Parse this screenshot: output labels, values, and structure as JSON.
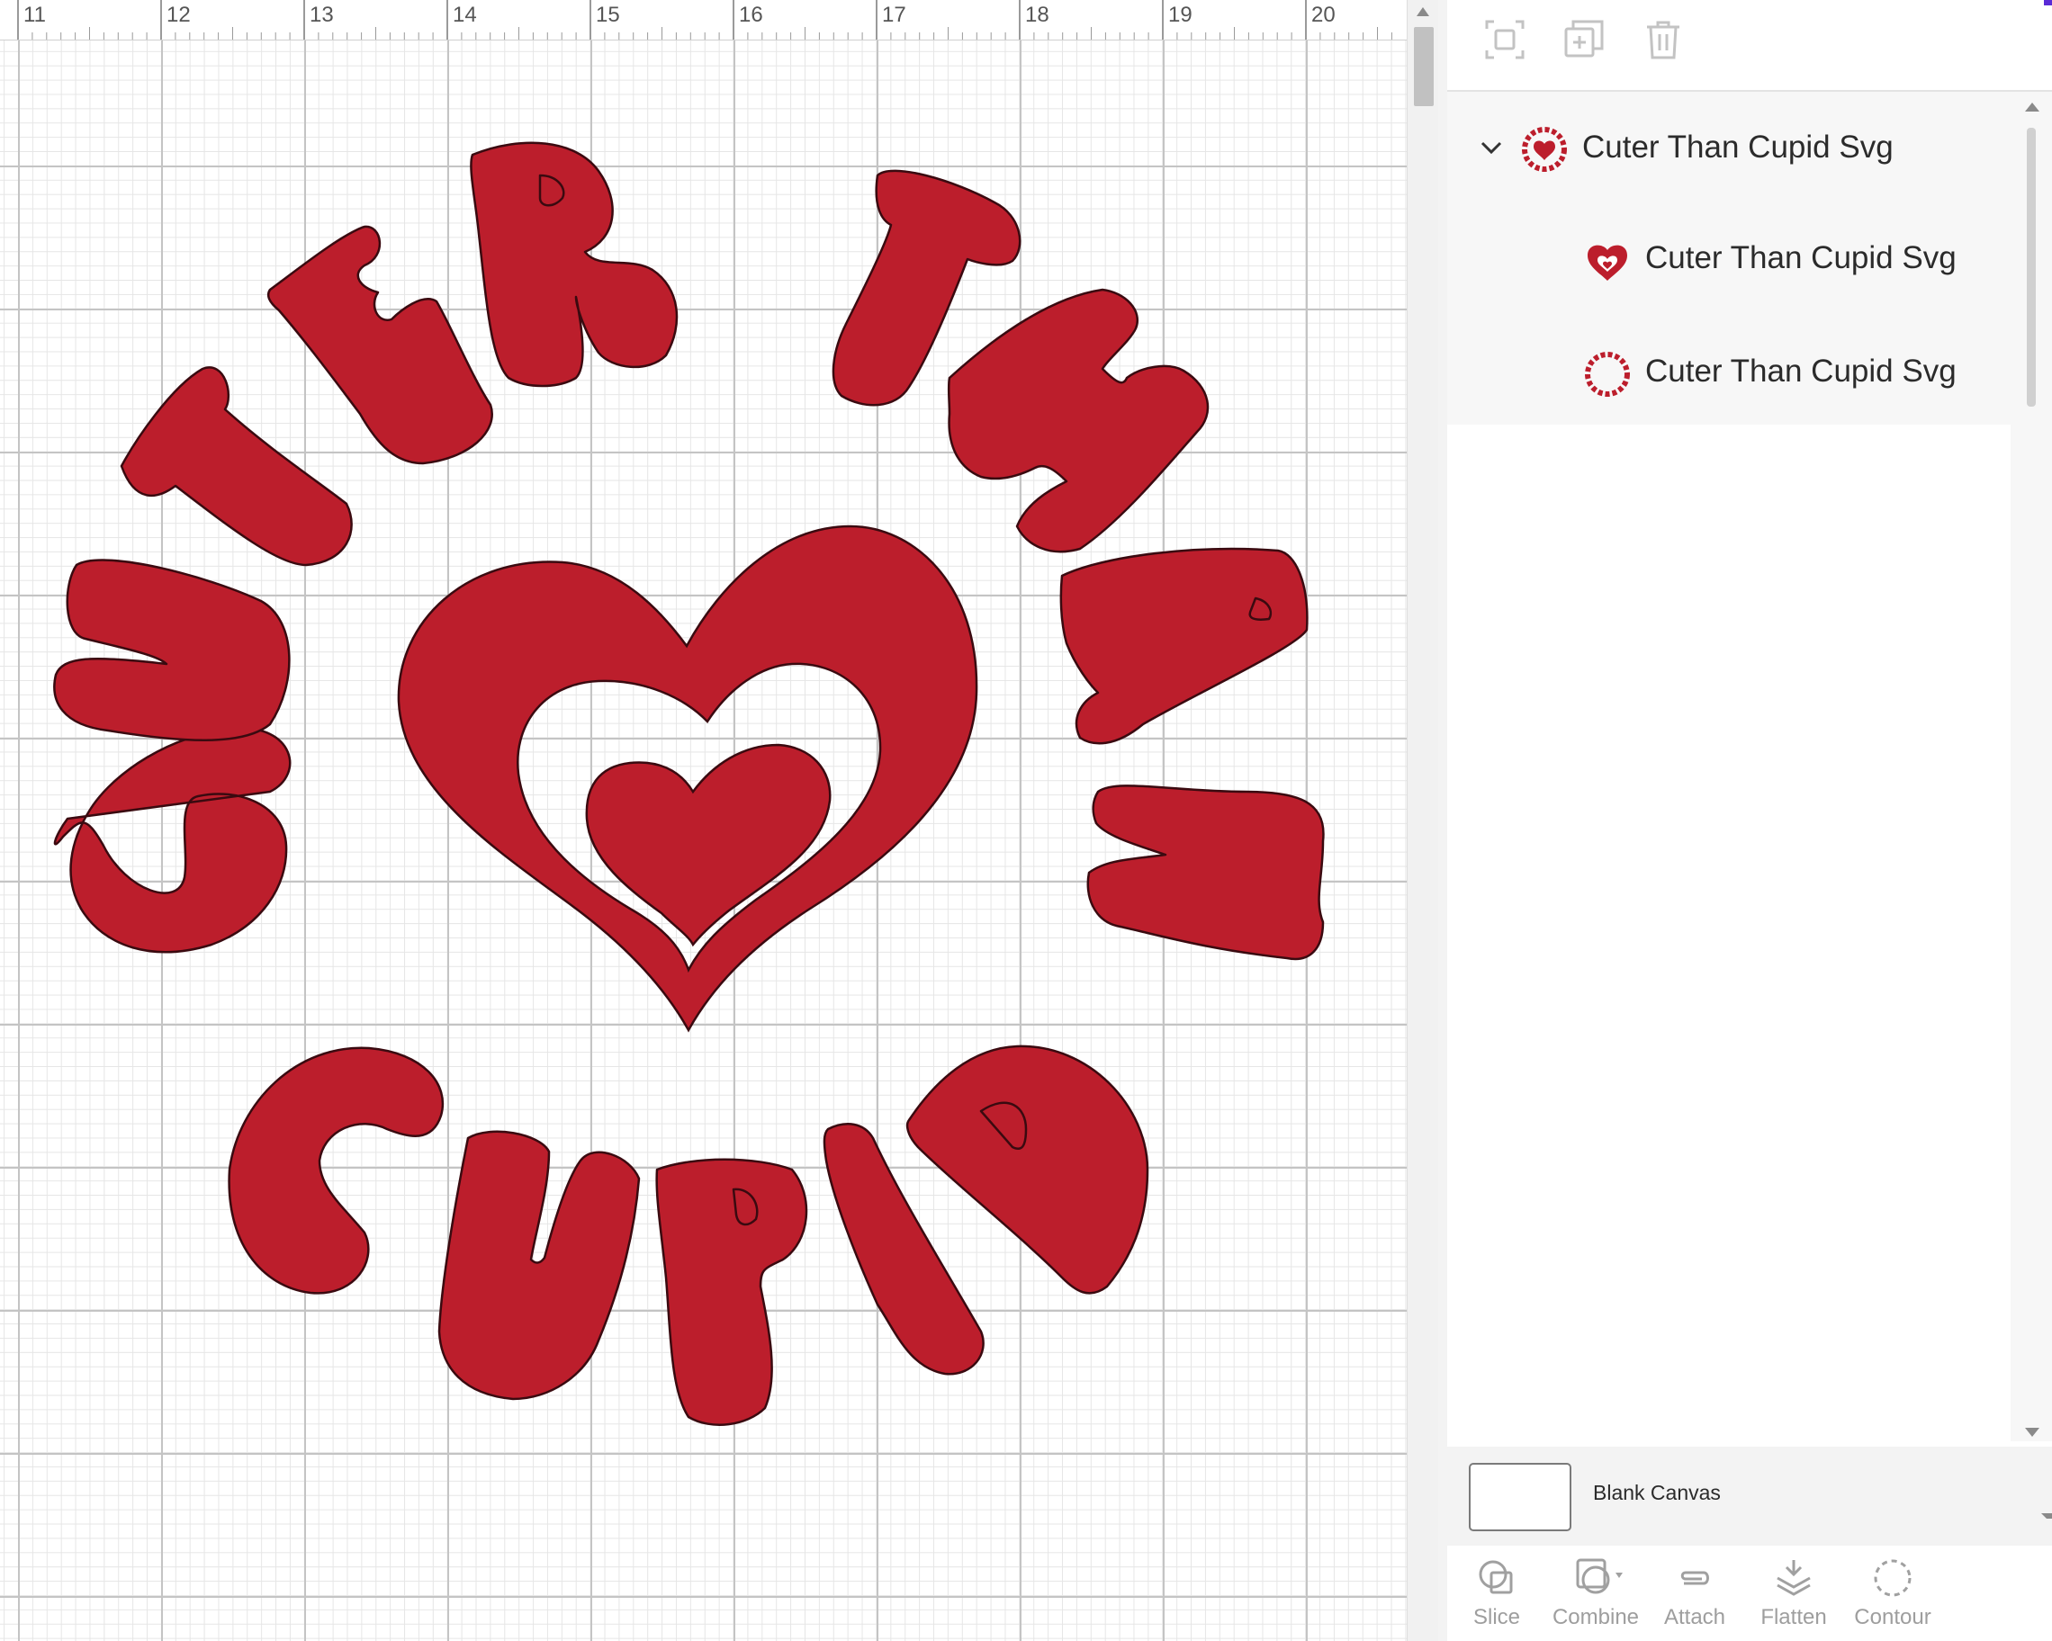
{
  "ruler": {
    "ticks": [
      "11",
      "12",
      "13",
      "14",
      "15",
      "16",
      "17",
      "18",
      "19",
      "20"
    ]
  },
  "design": {
    "color": "#BC1E2C",
    "stroke": "#3a0a10",
    "letters": [
      "C",
      "U",
      "T",
      "E",
      "R",
      "T",
      "H",
      "A",
      "N",
      "C",
      "U",
      "P",
      "I",
      "D"
    ],
    "icon": "heart-in-heart-icon"
  },
  "toolbar": {
    "icons": [
      "group-icon",
      "duplicate-icon",
      "delete-icon"
    ]
  },
  "layers": {
    "group": {
      "label": "Cuter Than Cupid Svg",
      "icon": "chevron-down-icon"
    },
    "children": [
      {
        "label": "Cuter Than Cupid Svg",
        "icon": "heart-thumbnail-icon"
      },
      {
        "label": "Cuter Than Cupid Svg",
        "icon": "text-circle-thumbnail-icon"
      }
    ]
  },
  "canvas_setting": {
    "label": "Blank Canvas"
  },
  "actions": [
    {
      "label": "Slice",
      "icon": "slice-icon"
    },
    {
      "label": "Combine",
      "icon": "combine-icon"
    },
    {
      "label": "Attach",
      "icon": "attach-icon"
    },
    {
      "label": "Flatten",
      "icon": "flatten-icon"
    },
    {
      "label": "Contour",
      "icon": "contour-icon"
    }
  ]
}
